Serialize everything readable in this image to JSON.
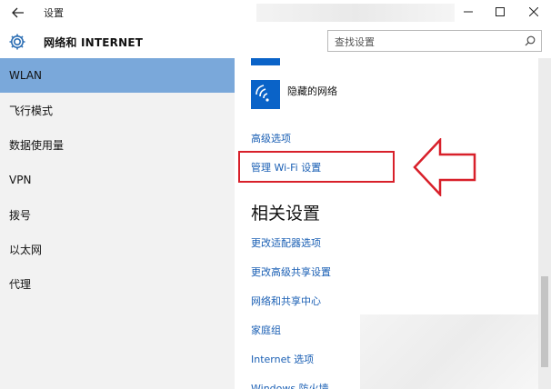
{
  "window": {
    "title": "设置"
  },
  "header": {
    "title": "网络和 INTERNET",
    "search_placeholder": "查找设置"
  },
  "sidebar": {
    "items": [
      {
        "label": "WLAN",
        "active": true
      },
      {
        "label": "飞行模式",
        "active": false
      },
      {
        "label": "数据使用量",
        "active": false
      },
      {
        "label": "VPN",
        "active": false
      },
      {
        "label": "拨号",
        "active": false
      },
      {
        "label": "以太网",
        "active": false
      },
      {
        "label": "代理",
        "active": false
      }
    ]
  },
  "main": {
    "hidden_network": "隐藏的网络",
    "advanced_options": "高级选项",
    "manage_wifi": "管理 Wi-Fi 设置",
    "related_heading": "相关设置",
    "related_links": [
      "更改适配器选项",
      "更改高级共享设置",
      "网络和共享中心",
      "家庭组",
      "Internet 选项",
      "Windows 防火墙"
    ]
  },
  "icons": {
    "back": "back-arrow-icon",
    "minimize": "minimize-icon",
    "maximize": "maximize-icon",
    "close": "close-icon",
    "settings": "gear-icon",
    "search": "search-icon",
    "wifi": "wifi-icon",
    "annotation": "arrow-left-icon"
  },
  "colors": {
    "accent": "#7aa8da",
    "link": "#1a5fb4",
    "wifi_tile": "#0a63c8",
    "annotation": "#d8202a"
  }
}
